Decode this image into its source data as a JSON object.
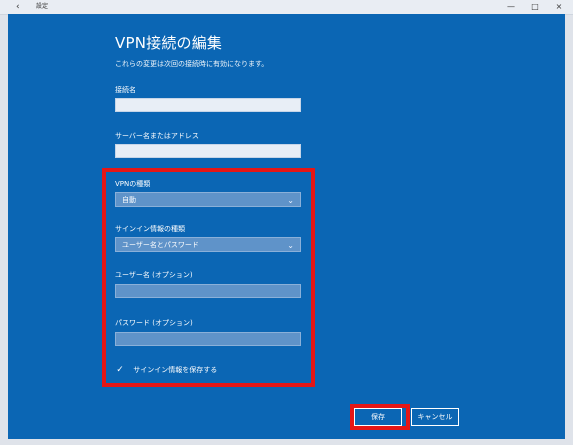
{
  "window": {
    "back_glyph": "‹",
    "title": "設定",
    "minimize_glyph": "—",
    "maximize_glyph": "□",
    "close_glyph": "×"
  },
  "dialog": {
    "title": "VPN接続の編集",
    "subtitle": "これらの変更は次回の接続時に有効になります。",
    "connection_name": {
      "label": "接続名",
      "value": ""
    },
    "server": {
      "label": "サーバー名またはアドレス",
      "value": ""
    },
    "vpn_type": {
      "label": "VPNの種類",
      "value": "自動"
    },
    "signin_type": {
      "label": "サインイン情報の種類",
      "value": "ユーザー名とパスワード"
    },
    "username": {
      "label": "ユーザー名 (オプション)",
      "value": ""
    },
    "password": {
      "label": "パスワード (オプション)",
      "value": ""
    },
    "remember": {
      "label": "サインイン情報を保存する",
      "checked": true
    },
    "buttons": {
      "save": "保存",
      "cancel": "キャンセル"
    }
  },
  "colors": {
    "dialog_bg": "#0b66b4",
    "highlight": "#e51616"
  }
}
